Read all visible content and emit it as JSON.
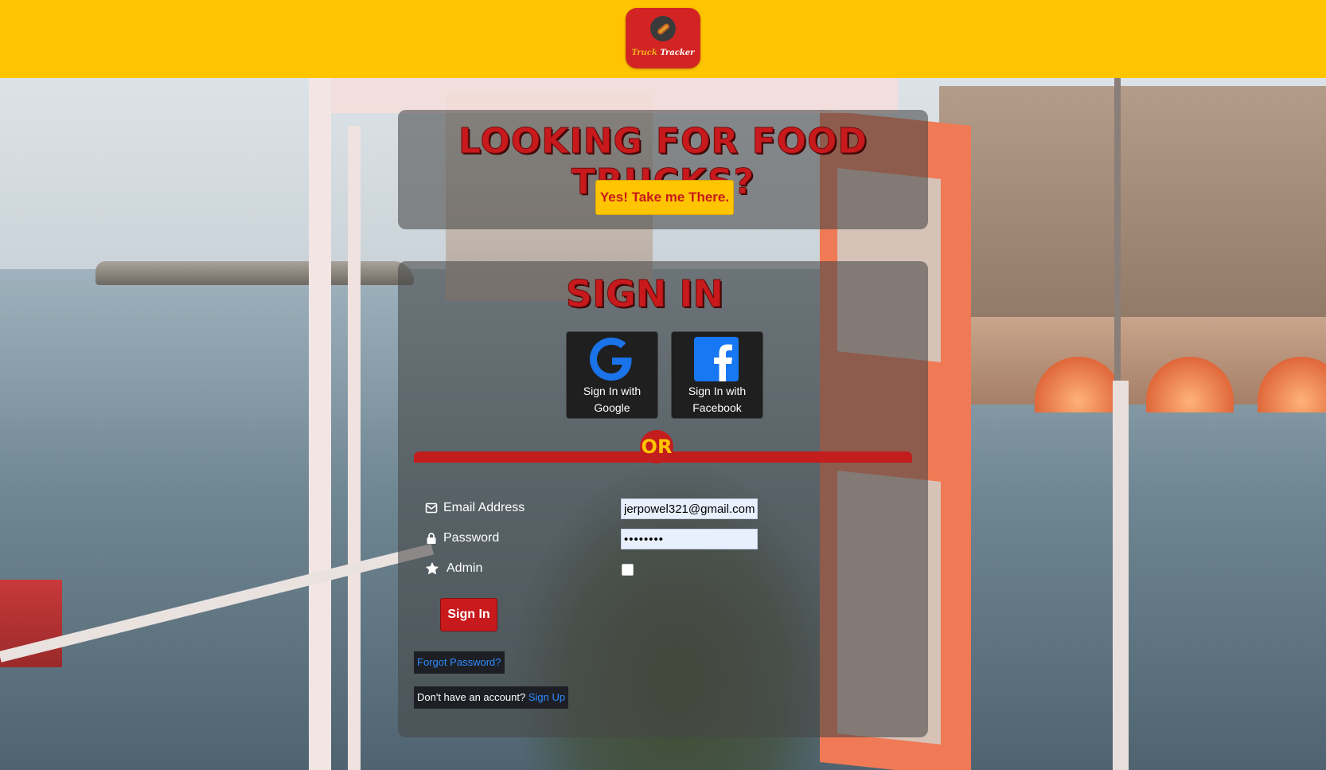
{
  "brand": {
    "logo_word1": "Truck",
    "logo_word2": "Tracker",
    "primary_color": "#ffc500",
    "accent_color": "#c8191c"
  },
  "hero": {
    "headline": "Looking for Food Trucks?",
    "cta_label": "Yes! Take me There."
  },
  "signin": {
    "title": "Sign In",
    "google_label": "Sign In with Google",
    "facebook_label": "Sign In with Facebook",
    "or_label": "OR",
    "email_label": "Email Address",
    "email_value": "jerpowel321@gmail.com",
    "password_label": "Password",
    "password_value": "jerpowel",
    "admin_label": "Admin",
    "admin_checked": false,
    "submit_label": "Sign In",
    "forgot_label": "Forgot Password?",
    "no_account_text": "Don't have an account?",
    "signup_label": "Sign Up"
  },
  "icons": {
    "email": "envelope-icon",
    "password": "lock-icon",
    "admin": "star-icon",
    "google": "google-icon",
    "facebook": "facebook-icon"
  }
}
